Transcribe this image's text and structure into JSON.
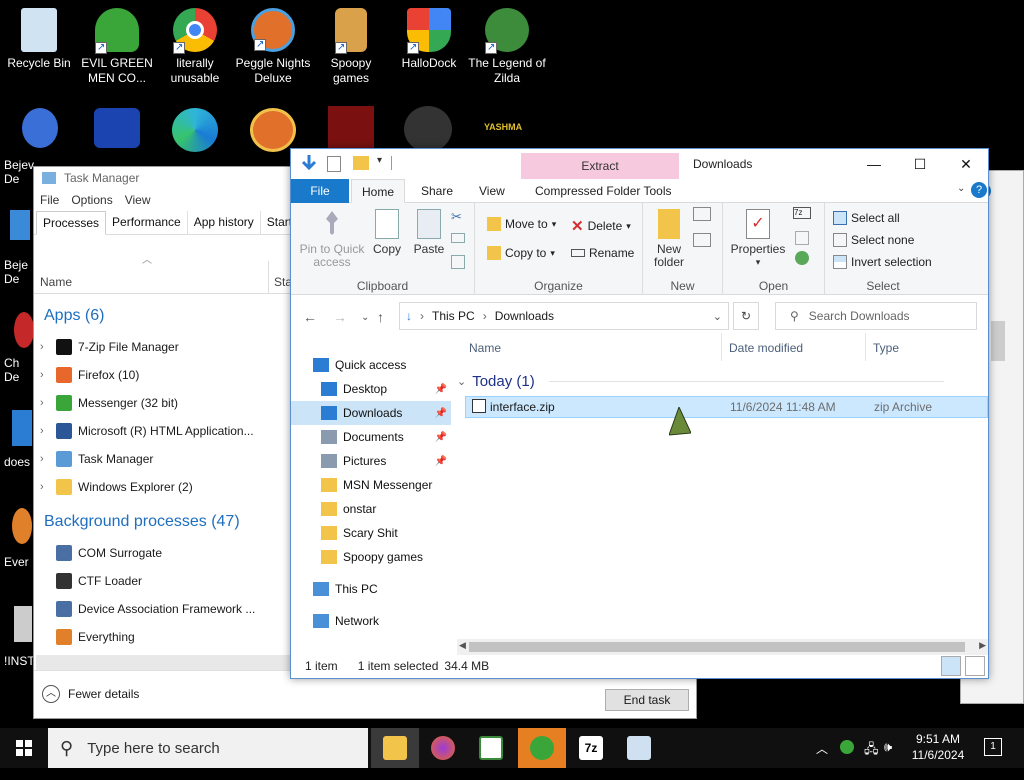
{
  "desktop": {
    "icons": [
      {
        "label": "Recycle Bin",
        "color": "#9fc9e8"
      },
      {
        "label": "EVIL GREEN MEN CO...",
        "color": "#3aa63a"
      },
      {
        "label": "literally unusable",
        "color": "#e94235"
      },
      {
        "label": "Peggle Nights Deluxe",
        "color": "#e0702a"
      },
      {
        "label": "Spoopy games",
        "color": "#d9a24a"
      },
      {
        "label": "HalloDock",
        "color": "#4a90d9"
      },
      {
        "label": "The Legend of Zilda",
        "color": "#3c8c3c"
      }
    ],
    "fragments": [
      "Bejev De",
      "Beje De",
      "Ch De",
      "does",
      "Ever",
      "!INSTA"
    ]
  },
  "task_manager": {
    "title": "Task Manager",
    "menu": [
      "File",
      "Options",
      "View"
    ],
    "tabs": [
      "Processes",
      "Performance",
      "App history",
      "Startup"
    ],
    "col_name": "Name",
    "col_status": "Sta",
    "apps_header": "Apps (6)",
    "apps": [
      {
        "label": "7-Zip File Manager",
        "color": "#111"
      },
      {
        "label": "Firefox (10)",
        "color": "#e8672a"
      },
      {
        "label": "Messenger (32 bit)",
        "color": "#3aa63a"
      },
      {
        "label": "Microsoft (R) HTML Application...",
        "color": "#2b5797"
      },
      {
        "label": "Task Manager",
        "color": "#5a9bd5"
      },
      {
        "label": "Windows Explorer (2)",
        "color": "#f3c44a"
      }
    ],
    "bg_header": "Background processes (47)",
    "bg": [
      {
        "label": "COM Surrogate",
        "color": "#4a6fa5"
      },
      {
        "label": "CTF Loader",
        "color": "#333"
      },
      {
        "label": "Device Association Framework ...",
        "color": "#4a6fa5"
      },
      {
        "label": "Everything",
        "color": "#e0802a"
      }
    ],
    "fewer_details": "Fewer details",
    "end_task": "End task"
  },
  "explorer": {
    "contextual_tab": "Extract",
    "title": "Downloads",
    "tabs": {
      "file": "File",
      "home": "Home",
      "share": "Share",
      "view": "View",
      "compressed": "Compressed Folder Tools"
    },
    "clipboard": {
      "pin": "Pin to Quick access",
      "copy": "Copy",
      "paste": "Paste",
      "group": "Clipboard"
    },
    "organize": {
      "move_to": "Move to",
      "copy_to": "Copy to",
      "delete": "Delete",
      "rename": "Rename",
      "group": "Organize"
    },
    "new": {
      "new_folder": "New folder",
      "group": "New"
    },
    "open": {
      "properties": "Properties",
      "group": "Open"
    },
    "select": {
      "select_all": "Select all",
      "select_none": "Select none",
      "invert": "Invert selection",
      "group": "Select"
    },
    "address": {
      "this_pc": "This PC",
      "folder": "Downloads"
    },
    "search_placeholder": "Search Downloads",
    "nav": [
      {
        "label": "Quick access",
        "color": "#2b7cd3",
        "pin": false
      },
      {
        "label": "Desktop",
        "color": "#2b7cd3",
        "pin": true
      },
      {
        "label": "Downloads",
        "color": "#2b7cd3",
        "pin": true
      },
      {
        "label": "Documents",
        "color": "#8a9bb0",
        "pin": true
      },
      {
        "label": "Pictures",
        "color": "#8a9bb0",
        "pin": true
      },
      {
        "label": "MSN Messenger",
        "color": "#f3c44a",
        "pin": false
      },
      {
        "label": "onstar",
        "color": "#f3c44a",
        "pin": false
      },
      {
        "label": "Scary Shit",
        "color": "#f3c44a",
        "pin": false
      },
      {
        "label": "Spoopy games",
        "color": "#f3c44a",
        "pin": false
      },
      {
        "label": "This PC",
        "color": "#4a90d9",
        "pin": false
      },
      {
        "label": "Network",
        "color": "#4a90d9",
        "pin": false
      }
    ],
    "columns": {
      "name": "Name",
      "date": "Date modified",
      "type": "Type"
    },
    "group_label": "Today (1)",
    "file": {
      "name": "interface.zip",
      "date": "11/6/2024 11:48 AM",
      "type": "zip Archive"
    },
    "status": {
      "count": "1 item",
      "selected": "1 item selected",
      "size": "34.4 MB"
    }
  },
  "taskbar": {
    "search_placeholder": "Type here to search",
    "time": "9:51 AM",
    "date": "11/6/2024",
    "notifications": "1"
  }
}
